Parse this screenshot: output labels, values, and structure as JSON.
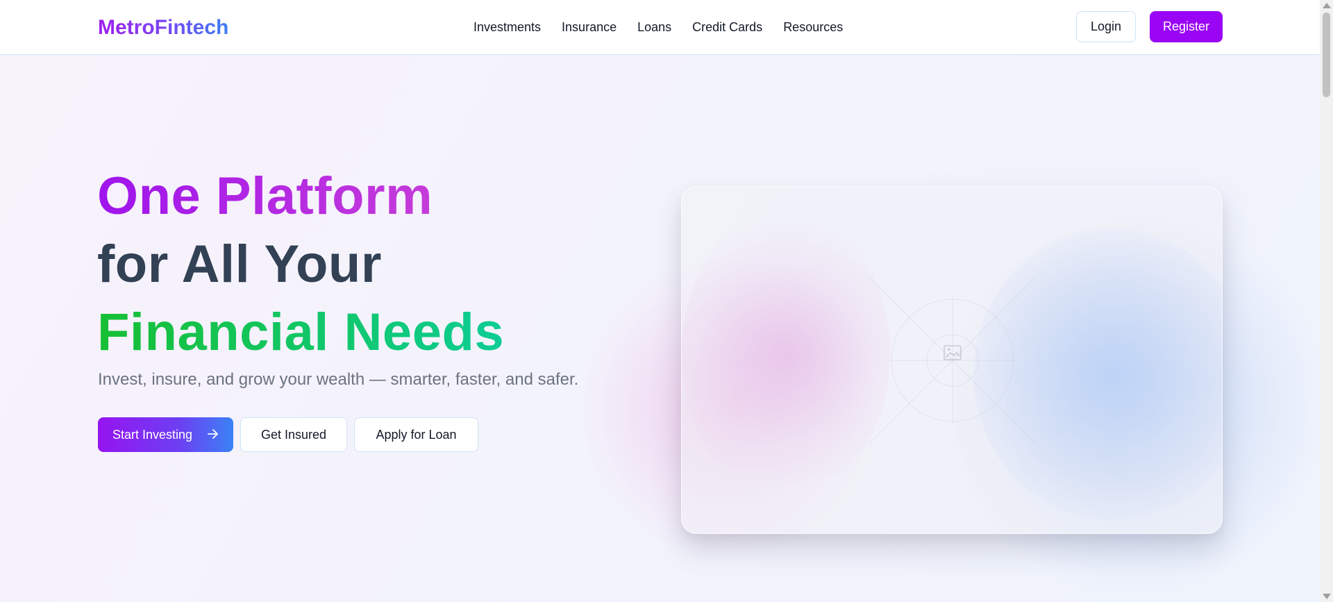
{
  "brand": {
    "name": "MetroFintech"
  },
  "nav": {
    "items": [
      {
        "label": "Investments"
      },
      {
        "label": "Insurance"
      },
      {
        "label": "Loans"
      },
      {
        "label": "Credit Cards"
      },
      {
        "label": "Resources"
      }
    ],
    "login_label": "Login",
    "register_label": "Register"
  },
  "hero": {
    "headline_line1": "One Platform",
    "headline_line2": "for All Your",
    "headline_line3": "Financial Needs",
    "subtitle": "Invest, insure, and grow your wealth — smarter, faster, and safer.",
    "primary_cta": "Start Investing",
    "secondary_cta": "Get Insured",
    "tertiary_cta": "Apply for Loan",
    "primary_cta_icon": "arrow-right-icon",
    "image_placeholder_icon": "image-icon"
  },
  "colors": {
    "brand_purple": "#9a06f5",
    "accent_blue": "#3b82f6",
    "headline_green": "#10c46a",
    "headline_dark": "#334155"
  }
}
